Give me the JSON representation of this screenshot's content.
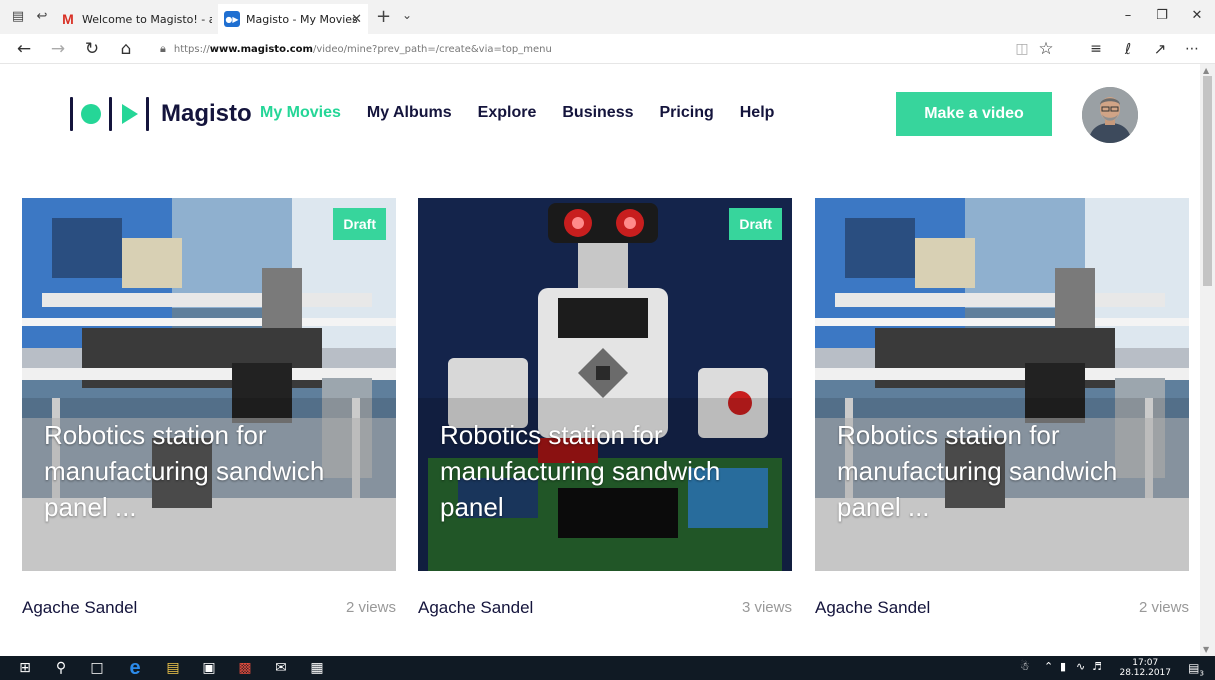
{
  "browser": {
    "tabs": [
      {
        "title": "Welcome to Magisto! - agac",
        "icon": "gmail-icon"
      },
      {
        "title": "Magisto - My Movies",
        "icon": "magisto-icon",
        "active": true
      }
    ],
    "url_prefix": "https://",
    "url_host": "www.magisto.com",
    "url_path": "/video/mine?prev_path=/create&via=top_menu"
  },
  "site": {
    "logo_text": "Magisto",
    "nav": [
      {
        "label": "My Movies",
        "active": true
      },
      {
        "label": "My Albums"
      },
      {
        "label": "Explore"
      },
      {
        "label": "Business"
      },
      {
        "label": "Pricing"
      },
      {
        "label": "Help"
      }
    ],
    "make_video_label": "Make a video",
    "accent_color": "#37d59c",
    "text_color": "#14143c"
  },
  "movies": [
    {
      "badge": "Draft",
      "title": "Robotics station for manufacturing sandwich panel ...",
      "owner": "Agache Sandel",
      "views": "2 views"
    },
    {
      "badge": "Draft",
      "title": "Robotics station for manufacturing sandwich panel",
      "owner": "Agache Sandel",
      "views": "3 views"
    },
    {
      "badge": "",
      "title": "Robotics station for manufacturing sandwich panel ...",
      "owner": "Agache Sandel",
      "views": "2 views"
    }
  ],
  "taskbar": {
    "time": "17:07",
    "date": "28.12.2017",
    "notification_count": "3"
  }
}
